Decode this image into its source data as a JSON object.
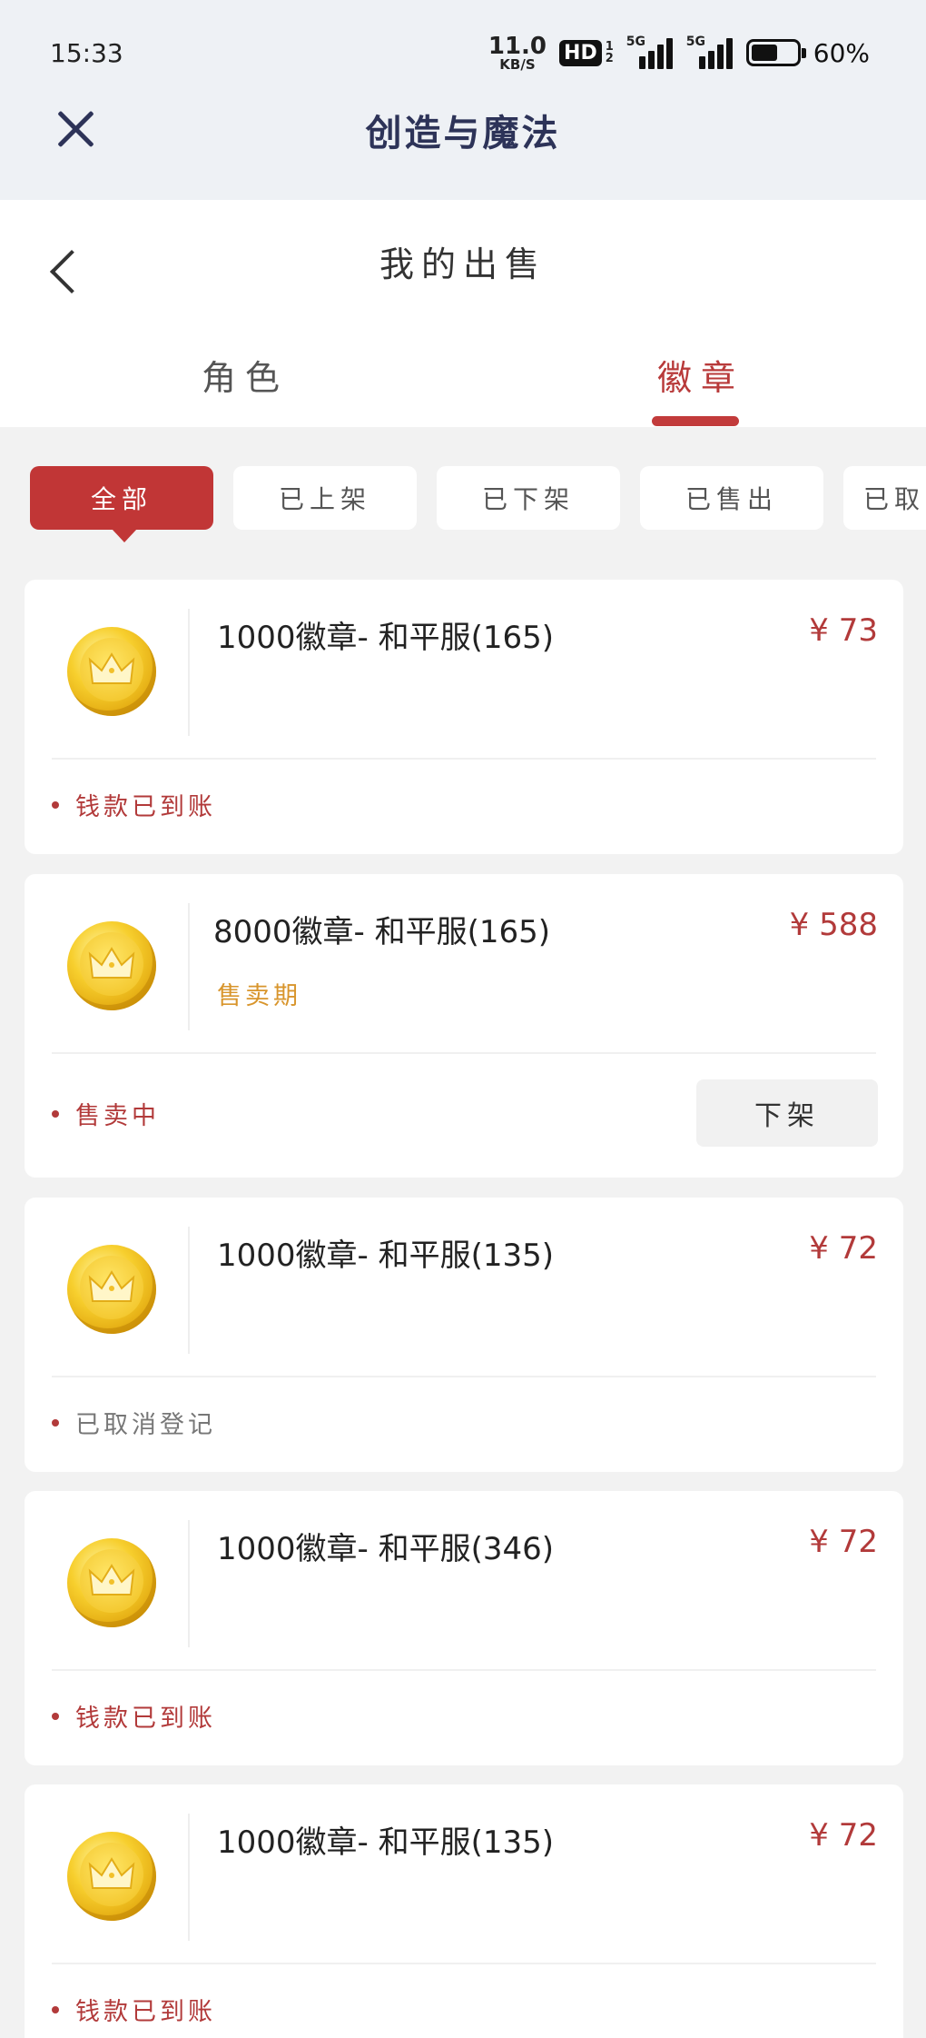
{
  "status_bar": {
    "time": "15:33",
    "net_speed_value": "11.0",
    "net_speed_unit": "KB/S",
    "hd_label": "HD",
    "hd_sub_top": "1",
    "hd_sub_bottom": "2",
    "signal1_label": "5G",
    "signal2_label": "5G",
    "battery_text": "60%"
  },
  "app": {
    "title": "创造与魔法"
  },
  "header": {
    "title": "我的出售",
    "tabs": [
      {
        "label": "角色",
        "active": false
      },
      {
        "label": "徽章",
        "active": true
      }
    ]
  },
  "filters": [
    {
      "label": "全部",
      "active": true
    },
    {
      "label": "已上架",
      "active": false
    },
    {
      "label": "已下架",
      "active": false
    },
    {
      "label": "已售出",
      "active": false
    },
    {
      "label": "已取消",
      "active": false
    }
  ],
  "items": [
    {
      "name": "1000徽章- 和平服(165)",
      "price": "¥ 73",
      "status": "钱款已到账",
      "sub_tag": "",
      "action": ""
    },
    {
      "name": "8000徽章- 和平服(165)",
      "price": "¥ 588",
      "status": "售卖中",
      "sub_tag": "售卖期",
      "action": "下架"
    },
    {
      "name": "1000徽章- 和平服(135)",
      "price": "¥ 72",
      "status": "已取消登记",
      "sub_tag": "",
      "action": ""
    },
    {
      "name": "1000徽章- 和平服(346)",
      "price": "¥ 72",
      "status": "钱款已到账",
      "sub_tag": "",
      "action": ""
    },
    {
      "name": "1000徽章- 和平服(135)",
      "price": "¥ 72",
      "status": "钱款已到账",
      "sub_tag": "",
      "action": ""
    }
  ],
  "colors": {
    "accent": "#c13636",
    "price": "#b23a3a",
    "sub_tag": "#d8952c",
    "title": "#2d3358"
  }
}
